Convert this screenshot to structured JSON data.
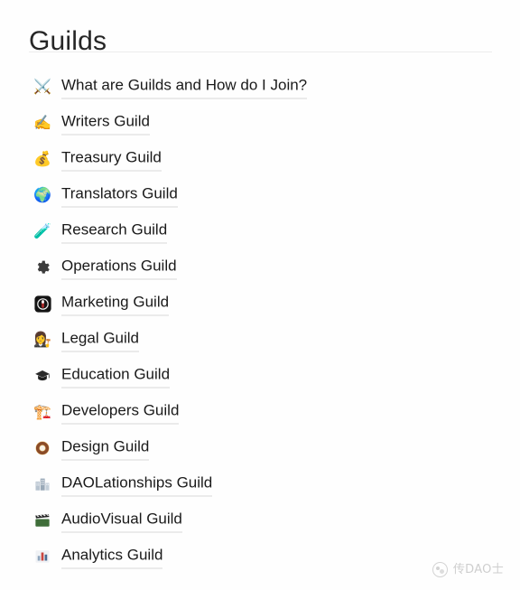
{
  "page": {
    "title": "Guilds",
    "background_color": "#ffffff",
    "text_color": "#1a1a1a",
    "divider_color": "#ededed",
    "underline_color": "#d8d8d8"
  },
  "guilds": [
    {
      "label": "What are Guilds and How do I Join?",
      "icon": "crossed-swords-icon",
      "glyph": "⚔️"
    },
    {
      "label": "Writers Guild",
      "icon": "writing-hand-icon",
      "glyph": "✍️"
    },
    {
      "label": "Treasury Guild",
      "icon": "money-bag-icon",
      "glyph": "💰"
    },
    {
      "label": "Translators Guild",
      "icon": "globe-icon",
      "glyph": "🌍"
    },
    {
      "label": "Research Guild",
      "icon": "test-tube-icon",
      "glyph": "🧪"
    },
    {
      "label": "Operations Guild",
      "icon": "gear-icon",
      "glyph": "⚙️"
    },
    {
      "label": "Marketing Guild",
      "icon": "marketing-badge-icon",
      "glyph": "🎟️"
    },
    {
      "label": "Legal Guild",
      "icon": "judge-icon",
      "glyph": "👩‍⚖️"
    },
    {
      "label": "Education Guild",
      "icon": "graduation-cap-icon",
      "glyph": "🎓"
    },
    {
      "label": "Developers Guild",
      "icon": "construction-crane-icon",
      "glyph": "🏗️"
    },
    {
      "label": "Design Guild",
      "icon": "donut-icon",
      "glyph": "🍩"
    },
    {
      "label": "DAOLationships Guild",
      "icon": "buildings-icon",
      "glyph": "🏢"
    },
    {
      "label": "AudioVisual Guild",
      "icon": "clapper-board-icon",
      "glyph": "🎬"
    },
    {
      "label": "Analytics Guild",
      "icon": "bar-chart-icon",
      "glyph": "📊"
    }
  ],
  "watermark": {
    "text": "传DAO士",
    "logo": "circular-logo-icon"
  }
}
